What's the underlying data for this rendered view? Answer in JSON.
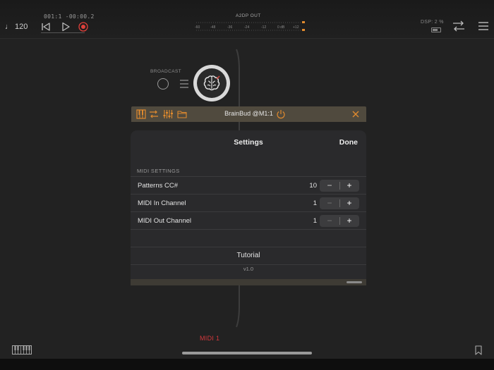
{
  "transport": {
    "tempo": "♩ 120",
    "timecode": "001:1 -00:00.2"
  },
  "meter": {
    "title": "A2DP OUT",
    "scale": [
      "-60",
      "-48",
      "-36",
      "-24",
      "-12",
      "0 dB",
      "+12"
    ]
  },
  "status": {
    "dsp": "DSP: 2 %"
  },
  "node": {
    "broadcast_label": "BROADCAST"
  },
  "host_bar": {
    "title": "BrainBud @M1:1"
  },
  "settings": {
    "title": "Settings",
    "done_label": "Done",
    "section_label": "MIDI SETTINGS",
    "rows": [
      {
        "label": "Patterns CC#",
        "value": "10"
      },
      {
        "label": "MIDI In Channel",
        "value": "1"
      },
      {
        "label": "MIDI Out Channel",
        "value": "1"
      }
    ],
    "stepper": {
      "minus": "−",
      "plus": "+"
    },
    "tutorial_label": "Tutorial",
    "version": "v1.0"
  },
  "bottom": {
    "midi_label": "MIDI 1"
  },
  "colors": {
    "accent_orange": "#e08a2e",
    "record_red": "#e0403a",
    "midi_red": "#d5383c"
  }
}
